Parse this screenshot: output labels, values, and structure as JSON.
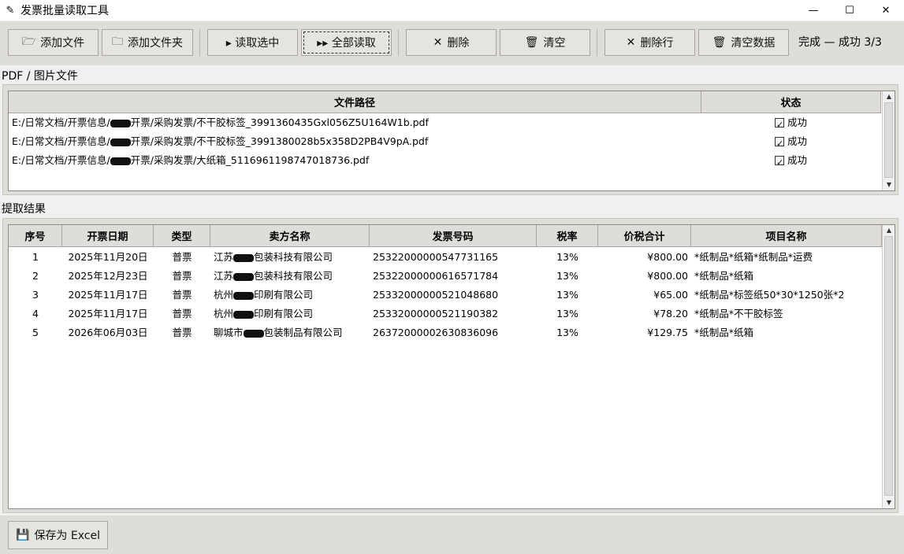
{
  "window": {
    "title": "发票批量读取工具",
    "icon": "feather-icon",
    "controls": [
      "minimize-icon",
      "maximize-icon",
      "close-icon"
    ]
  },
  "toolbar": {
    "add_file": "添加文件",
    "add_folder": "添加文件夹",
    "read_selected": "▸ 读取选中",
    "read_all": "▸▸ 全部读取",
    "delete": "删除",
    "clear": "清空",
    "delete_row": "删除行",
    "clear_data": "清空数据",
    "status": "完成 — 成功 3/3"
  },
  "files_section": {
    "label": "PDF / 图片文件",
    "columns": [
      "文件路径",
      "状态"
    ],
    "rows": [
      {
        "path_prefix": "E:/日常文档/开票信息/",
        "path_suffix": "开票/采购发票/不干胶标签_3991360435Gxl056Z5U164W1b.pdf",
        "status": "成功"
      },
      {
        "path_prefix": "E:/日常文档/开票信息/",
        "path_suffix": "开票/采购发票/不干胶标签_3991380028b5x358D2PB4V9pA.pdf",
        "status": "成功"
      },
      {
        "path_prefix": "E:/日常文档/开票信息/",
        "path_suffix": "开票/采购发票/大纸箱_5116961198747018736.pdf",
        "status": "成功"
      }
    ]
  },
  "results_section": {
    "label": "提取结果",
    "columns": [
      "序号",
      "开票日期",
      "类型",
      "卖方名称",
      "发票号码",
      "税率",
      "价税合计",
      "项目名称"
    ],
    "rows": [
      {
        "no": "1",
        "date": "2025年11月20日",
        "type": "普票",
        "seller_prefix": "江苏",
        "seller_suffix": "包装科技有限公司",
        "invoice_no": "25322000000547731165",
        "tax": "13%",
        "total": "¥800.00",
        "item": "*纸制品*纸箱*纸制品*运费"
      },
      {
        "no": "2",
        "date": "2025年12月23日",
        "type": "普票",
        "seller_prefix": "江苏",
        "seller_suffix": "包装科技有限公司",
        "invoice_no": "25322000000616571784",
        "tax": "13%",
        "total": "¥800.00",
        "item": "*纸制品*纸箱"
      },
      {
        "no": "3",
        "date": "2025年11月17日",
        "type": "普票",
        "seller_prefix": "杭州",
        "seller_suffix": "印刷有限公司",
        "invoice_no": "25332000000521048680",
        "tax": "13%",
        "total": "¥65.00",
        "item": "*纸制品*标签纸50*30*1250张*2"
      },
      {
        "no": "4",
        "date": "2025年11月17日",
        "type": "普票",
        "seller_prefix": "杭州",
        "seller_suffix": "印刷有限公司",
        "invoice_no": "25332000000521190382",
        "tax": "13%",
        "total": "¥78.20",
        "item": "*纸制品*不干胶标签"
      },
      {
        "no": "5",
        "date": "2026年06月03日",
        "type": "普票",
        "seller_prefix": "聊城市",
        "seller_suffix": "包装制品有限公司",
        "invoice_no": "26372000002630836096",
        "tax": "13%",
        "total": "¥129.75",
        "item": "*纸制品*纸箱"
      }
    ]
  },
  "bottom": {
    "save_excel": "保存为 Excel"
  },
  "colors": {
    "toolbar_bg": "#dfddd8",
    "list_bg": "#ffffff",
    "header_bg": "#dfddd8"
  }
}
